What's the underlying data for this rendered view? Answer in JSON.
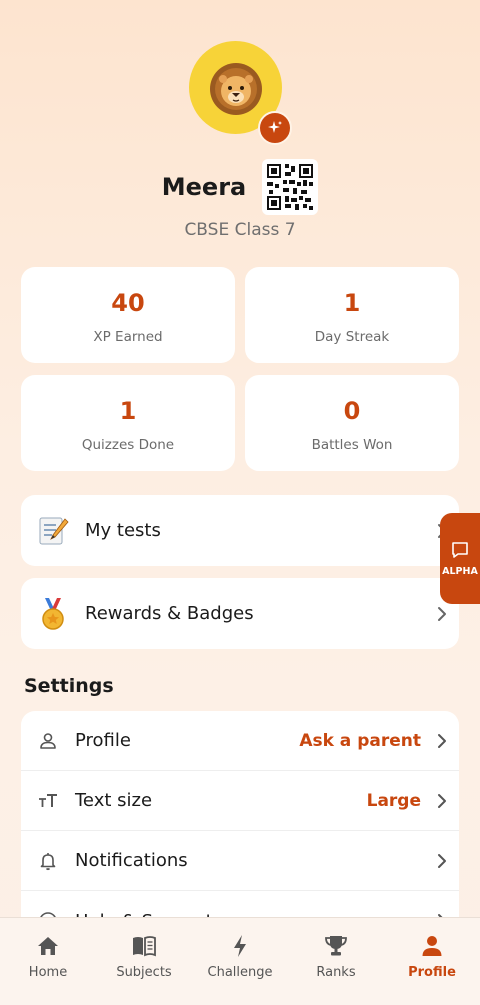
{
  "profile": {
    "name": "Meera",
    "class_label": "CBSE Class 7"
  },
  "stats": [
    {
      "value": "40",
      "label": "XP Earned"
    },
    {
      "value": "1",
      "label": "Day Streak"
    },
    {
      "value": "1",
      "label": "Quizzes Done"
    },
    {
      "value": "0",
      "label": "Battles Won"
    }
  ],
  "links": [
    {
      "label": "My tests",
      "icon": "memo-icon"
    },
    {
      "label": "Rewards & Badges",
      "icon": "medal-icon"
    }
  ],
  "settings": {
    "title": "Settings",
    "rows": [
      {
        "label": "Profile",
        "value": "Ask a parent",
        "icon": "person-icon"
      },
      {
        "label": "Text size",
        "value": "Large",
        "icon": "text-size-icon"
      },
      {
        "label": "Notifications",
        "value": "",
        "icon": "bell-icon"
      },
      {
        "label": "Help & Support",
        "value": "",
        "icon": "help-icon"
      }
    ]
  },
  "alpha_tab": {
    "label": "ALPHA"
  },
  "nav": [
    {
      "label": "Home",
      "icon": "home-icon"
    },
    {
      "label": "Subjects",
      "icon": "book-icon"
    },
    {
      "label": "Challenge",
      "icon": "lightning-icon"
    },
    {
      "label": "Ranks",
      "icon": "trophy-icon"
    },
    {
      "label": "Profile",
      "icon": "person-icon",
      "active": true
    }
  ],
  "colors": {
    "accent": "#c8470f",
    "avatar_bg": "#f7d338"
  }
}
